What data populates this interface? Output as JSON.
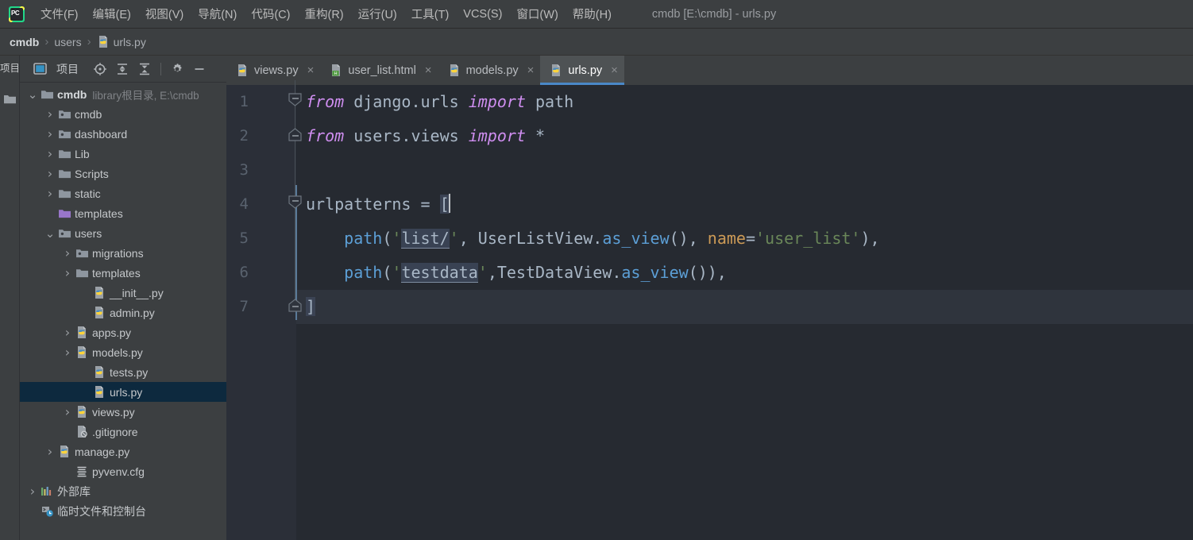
{
  "window": {
    "title": "cmdb [E:\\cmdb] - urls.py",
    "logo_text": "PC"
  },
  "menubar": {
    "items": [
      {
        "label": "文件(F)",
        "name": "menu-file"
      },
      {
        "label": "编辑(E)",
        "name": "menu-edit"
      },
      {
        "label": "视图(V)",
        "name": "menu-view"
      },
      {
        "label": "导航(N)",
        "name": "menu-navigate"
      },
      {
        "label": "代码(C)",
        "name": "menu-code"
      },
      {
        "label": "重构(R)",
        "name": "menu-refactor"
      },
      {
        "label": "运行(U)",
        "name": "menu-run"
      },
      {
        "label": "工具(T)",
        "name": "menu-tools"
      },
      {
        "label": "VCS(S)",
        "name": "menu-vcs"
      },
      {
        "label": "窗口(W)",
        "name": "menu-window"
      },
      {
        "label": "帮助(H)",
        "name": "menu-help"
      }
    ]
  },
  "breadcrumb": {
    "items": [
      "cmdb",
      "users",
      "urls.py"
    ],
    "separator": "›"
  },
  "toolstrip": {
    "project_tab": "项目"
  },
  "project_panel": {
    "title": "项目",
    "buttons": [
      "locate-icon",
      "expand-all-icon",
      "collapse-all-icon",
      "gear-icon",
      "minimize-icon"
    ],
    "tree": [
      {
        "label": "cmdb",
        "sub": "library根目录, E:\\cmdb",
        "depth": 0,
        "arrow": "down",
        "icon": "folder",
        "bold": true,
        "selected": false
      },
      {
        "label": "cmdb",
        "sub": "",
        "depth": 1,
        "arrow": "right",
        "icon": "folder-module",
        "bold": false,
        "selected": false
      },
      {
        "label": "dashboard",
        "sub": "",
        "depth": 1,
        "arrow": "right",
        "icon": "folder-module",
        "bold": false,
        "selected": false
      },
      {
        "label": "Lib",
        "sub": "",
        "depth": 1,
        "arrow": "right",
        "icon": "folder",
        "bold": false,
        "selected": false
      },
      {
        "label": "Scripts",
        "sub": "",
        "depth": 1,
        "arrow": "right",
        "icon": "folder",
        "bold": false,
        "selected": false
      },
      {
        "label": "static",
        "sub": "",
        "depth": 1,
        "arrow": "right",
        "icon": "folder",
        "bold": false,
        "selected": false
      },
      {
        "label": "templates",
        "sub": "",
        "depth": 1,
        "arrow": "none",
        "icon": "folder-template",
        "bold": false,
        "selected": false
      },
      {
        "label": "users",
        "sub": "",
        "depth": 1,
        "arrow": "down",
        "icon": "folder-module",
        "bold": false,
        "selected": false
      },
      {
        "label": "migrations",
        "sub": "",
        "depth": 2,
        "arrow": "right",
        "icon": "folder-module",
        "bold": false,
        "selected": false
      },
      {
        "label": "templates",
        "sub": "",
        "depth": 2,
        "arrow": "right",
        "icon": "folder",
        "bold": false,
        "selected": false
      },
      {
        "label": "__init__.py",
        "sub": "",
        "depth": 3,
        "arrow": "none",
        "icon": "python",
        "bold": false,
        "selected": false
      },
      {
        "label": "admin.py",
        "sub": "",
        "depth": 3,
        "arrow": "none",
        "icon": "python",
        "bold": false,
        "selected": false
      },
      {
        "label": "apps.py",
        "sub": "",
        "depth": 2,
        "arrow": "right",
        "icon": "python",
        "bold": false,
        "selected": false
      },
      {
        "label": "models.py",
        "sub": "",
        "depth": 2,
        "arrow": "right",
        "icon": "python",
        "bold": false,
        "selected": false
      },
      {
        "label": "tests.py",
        "sub": "",
        "depth": 3,
        "arrow": "none",
        "icon": "python",
        "bold": false,
        "selected": false
      },
      {
        "label": "urls.py",
        "sub": "",
        "depth": 3,
        "arrow": "none",
        "icon": "python",
        "bold": false,
        "selected": true
      },
      {
        "label": "views.py",
        "sub": "",
        "depth": 2,
        "arrow": "right",
        "icon": "python",
        "bold": false,
        "selected": false
      },
      {
        "label": ".gitignore",
        "sub": "",
        "depth": 2,
        "arrow": "none",
        "icon": "gitignore",
        "bold": false,
        "selected": false
      },
      {
        "label": "manage.py",
        "sub": "",
        "depth": 1,
        "arrow": "right",
        "icon": "python",
        "bold": false,
        "selected": false
      },
      {
        "label": "pyvenv.cfg",
        "sub": "",
        "depth": 2,
        "arrow": "none",
        "icon": "cfg",
        "bold": false,
        "selected": false
      },
      {
        "label": "外部库",
        "sub": "",
        "depth": 0,
        "arrow": "right",
        "icon": "library",
        "bold": false,
        "selected": false
      },
      {
        "label": "临时文件和控制台",
        "sub": "",
        "depth": 0,
        "arrow": "none",
        "icon": "scratches",
        "bold": false,
        "selected": false
      }
    ]
  },
  "editor": {
    "tabs": [
      {
        "label": "views.py",
        "icon": "python-file-icon",
        "active": false
      },
      {
        "label": "user_list.html",
        "icon": "html-file-icon",
        "active": false
      },
      {
        "label": "models.py",
        "icon": "python-file-icon",
        "active": false
      },
      {
        "label": "urls.py",
        "icon": "python-file-icon",
        "active": true
      }
    ],
    "close_glyph": "×",
    "line_numbers": [
      "1",
      "2",
      "3",
      "4",
      "5",
      "6",
      "7"
    ],
    "code_lines": [
      "from django.urls import path",
      "from users.views import *",
      "",
      "urlpatterns = [",
      "    path('list/', UserListView.as_view(), name='user_list'),",
      "    path('testdata',TestDataView.as_view()),",
      "]"
    ],
    "caret_line": 7,
    "accent_color": "#4a88c7",
    "colors": {
      "background": "#262a31",
      "gutter": "#2b2f38",
      "keyword": "#cc7832",
      "keyword_import": "#cf8ef0",
      "string": "#6a8759",
      "function": "#5c9fd6",
      "parameter": "#cc9a56",
      "default_text": "#a9b7c6",
      "line_number": "#59626e"
    }
  }
}
